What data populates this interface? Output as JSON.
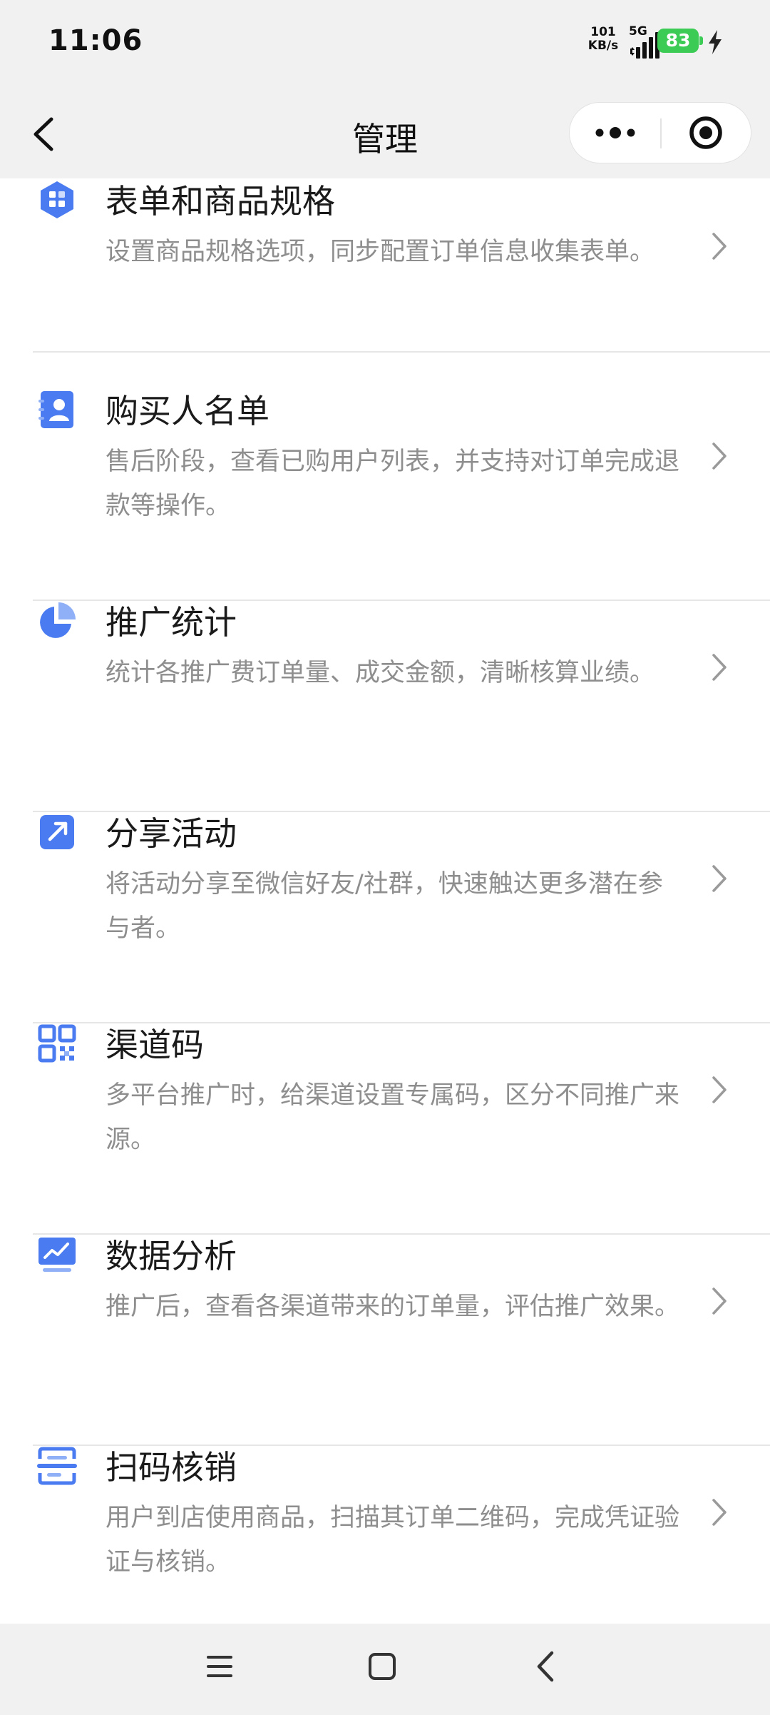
{
  "status_bar": {
    "time": "11:06",
    "net_speed_value": "101",
    "net_speed_unit": "KB/s",
    "network": "5G",
    "battery": "83"
  },
  "header": {
    "title": "管理",
    "more_icon": "more-dots-icon",
    "close_icon": "target-icon"
  },
  "colors": {
    "accent": "#4a7bf0",
    "accent_light": "#8fb0f7",
    "battery_green": "#3ccc55",
    "desc_gray": "#8e8e8e"
  },
  "items": [
    {
      "title": "表单和商品规格",
      "desc": "设置商品规格选项，同步配置订单信息收集表单。",
      "icon": "form-grid-icon"
    },
    {
      "title": "购买人名单",
      "desc": "售后阶段，查看已购用户列表，并支持对订单完成退款等操作。",
      "icon": "contact-card-icon"
    },
    {
      "title": "推广统计",
      "desc": "统计各推广费订单量、成交金额，清晰核算业绩。",
      "icon": "pie-chart-icon"
    },
    {
      "title": "分享活动",
      "desc": "将活动分享至微信好友/社群，快速触达更多潜在参与者。",
      "icon": "share-arrow-icon"
    },
    {
      "title": "渠道码",
      "desc": "多平台推广时，给渠道设置专属码，区分不同推广来源。",
      "icon": "qr-code-icon"
    },
    {
      "title": "数据分析",
      "desc": "推广后，查看各渠道带来的订单量，评估推广效果。",
      "icon": "trend-chart-icon"
    },
    {
      "title": "扫码核销",
      "desc": "用户到店使用商品，扫描其订单二维码，完成凭证验证与核销。",
      "icon": "scan-icon"
    }
  ]
}
